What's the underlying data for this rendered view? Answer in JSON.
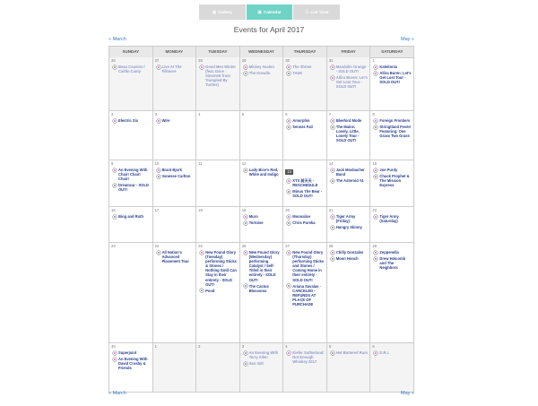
{
  "tabs": [
    {
      "label": "Gallery",
      "icon": "grid-icon",
      "active": false
    },
    {
      "label": "Calendar",
      "icon": "calendar-icon",
      "active": true
    },
    {
      "label": "List View",
      "icon": "list-icon",
      "active": false
    }
  ],
  "title": "Events for April 2017",
  "nav": {
    "prev": "« March",
    "next": "May »"
  },
  "days_of_week": [
    "SUNDAY",
    "MONDAY",
    "TUESDAY",
    "WEDNESDAY",
    "THURSDAY",
    "FRIDAY",
    "SATURDAY"
  ],
  "weeks": [
    [
      {
        "n": "26",
        "other": true,
        "events": [
          {
            "t": "Beau Cousins / Caitlin Canty",
            "c": "gray"
          }
        ]
      },
      {
        "n": "27",
        "other": true,
        "events": [
          {
            "t": "Live At The Fillmore",
            "c": "pink"
          }
        ]
      },
      {
        "n": "28",
        "other": true,
        "events": [
          {
            "t": "Good Men Winter (feat. Dave Simonett from Trampled By Turtles)",
            "c": "pink"
          }
        ]
      },
      {
        "n": "29",
        "other": true,
        "events": [
          {
            "t": "Mickey Avalon",
            "c": "pink"
          },
          {
            "t": "The Growlin",
            "c": "gray"
          }
        ]
      },
      {
        "n": "30",
        "other": true,
        "events": [
          {
            "t": "The Shrine",
            "c": "pink"
          },
          {
            "t": "TAUK",
            "c": "gray"
          }
        ]
      },
      {
        "n": "31",
        "other": true,
        "events": [
          {
            "t": "Mandolin Orange - SOLD OUT!",
            "c": "pink"
          },
          {
            "t": "Allira Buren: Let's Get Lost Tour - SOLD OUT!",
            "c": "pink"
          }
        ]
      },
      {
        "n": "1",
        "other": false,
        "events": [
          {
            "t": "Kaleitonia",
            "c": "pink"
          },
          {
            "t": "Allira Buren: Let's Get Lost Tour - SOLD OUT!",
            "c": "pink"
          }
        ]
      }
    ],
    [
      {
        "n": "2",
        "other": false,
        "events": [
          {
            "t": "Electric Six",
            "c": "pink"
          }
        ]
      },
      {
        "n": "3",
        "other": false,
        "events": [
          {
            "t": "Wire",
            "c": "pink"
          }
        ]
      },
      {
        "n": "4",
        "other": false,
        "events": []
      },
      {
        "n": "5",
        "other": false,
        "events": []
      },
      {
        "n": "6",
        "other": false,
        "events": [
          {
            "t": "Amorphis",
            "c": "pink"
          },
          {
            "t": "Senses Fail",
            "c": "gray"
          }
        ]
      },
      {
        "n": "7",
        "other": false,
        "events": [
          {
            "t": "Bleeford Mode",
            "c": "pink"
          },
          {
            "t": "The Maine: Lovely, Little, Lonely Tour - SOLD OUT!",
            "c": "gray"
          }
        ]
      },
      {
        "n": "8",
        "other": false,
        "events": [
          {
            "t": "Foreign Frontiers",
            "c": "pink"
          },
          {
            "t": "Stringtland Fever! Featuring: One Grass Two Grass",
            "c": "gray"
          }
        ]
      }
    ],
    [
      {
        "n": "9",
        "other": false,
        "events": [
          {
            "t": "An Evening With Chair! Chair! Chair!",
            "c": "pink"
          },
          {
            "t": "Dreamcar - SOLD OUT!",
            "c": "gray"
          }
        ]
      },
      {
        "n": "10",
        "other": false,
        "events": [
          {
            "t": "Brant Bjork",
            "c": "pink"
          },
          {
            "t": "Vanesse Carlton",
            "c": "gray"
          }
        ]
      },
      {
        "n": "11",
        "other": false,
        "events": []
      },
      {
        "n": "12",
        "other": false,
        "events": [
          {
            "t": "Lady Bice's Red, White and Indigo",
            "c": "gray"
          }
        ]
      },
      {
        "n": "13",
        "today": true,
        "other": false,
        "events": [
          {
            "t": "XTX 前天天 - RESCHEDULE",
            "c": "pink"
          },
          {
            "t": "Minus The Bear - SOLD OUT!",
            "c": "gray"
          }
        ]
      },
      {
        "n": "14",
        "other": false,
        "events": [
          {
            "t": "Jack Mosbacher Band",
            "c": "pink"
          },
          {
            "t": "The Asteroid #4",
            "c": "gray"
          }
        ]
      },
      {
        "n": "15",
        "other": false,
        "events": [
          {
            "t": "Joe Purdy",
            "c": "pink"
          },
          {
            "t": "Chuck Prophet & The Mission Express",
            "c": "gray"
          }
        ]
      }
    ],
    [
      {
        "n": "16",
        "other": false,
        "events": [
          {
            "t": "Bing and Ruth",
            "c": "gray"
          }
        ]
      },
      {
        "n": "17",
        "other": false,
        "events": []
      },
      {
        "n": "18",
        "other": false,
        "events": []
      },
      {
        "n": "19",
        "other": false,
        "events": [
          {
            "t": "Muro",
            "c": "pink"
          },
          {
            "t": "Tortoise",
            "c": "gray"
          }
        ]
      },
      {
        "n": "20",
        "other": false,
        "events": [
          {
            "t": "Moonalice",
            "c": "pink"
          },
          {
            "t": "Chris Pureka",
            "c": "gray"
          }
        ]
      },
      {
        "n": "21",
        "other": false,
        "events": [
          {
            "t": "Tiger Army (Friday)",
            "c": "pink"
          },
          {
            "t": "Hungry Skinny",
            "c": "gray"
          }
        ]
      },
      {
        "n": "22",
        "other": false,
        "events": [
          {
            "t": "Tiger Army (Saturday)",
            "c": "pink"
          }
        ]
      }
    ],
    [
      {
        "n": "23",
        "other": false,
        "events": []
      },
      {
        "n": "24",
        "other": false,
        "events": [
          {
            "t": "All Nation's Advanced Placement Tour",
            "c": "gray"
          }
        ]
      },
      {
        "n": "25",
        "other": false,
        "events": [
          {
            "t": "New Found Glory (Tuesday) performing Sticks & Stones / Nothing Gold Can Stay in their entirety - SOLD OUT!",
            "c": "pink"
          },
          {
            "t": "Pond",
            "c": "gray"
          }
        ]
      },
      {
        "n": "26",
        "other": false,
        "events": [
          {
            "t": "New Found Glory (Wednesday) performing Catalyst / Self-Titled in their entirety - SOLD OUT!",
            "c": "pink"
          },
          {
            "t": "The Cactus Blossoms",
            "c": "gray"
          }
        ]
      },
      {
        "n": "27",
        "other": false,
        "events": [
          {
            "t": "New Found Glory (Thursday) performing Sticks and Stones / Coming Home in their entirety - SOLD OUT!",
            "c": "pink"
          },
          {
            "t": "Ariana Savalas - CANCELED - REFUNDS AT PLACE OF PURCHASE",
            "c": "gray"
          }
        ]
      },
      {
        "n": "28",
        "other": false,
        "events": [
          {
            "t": "Chilly Gonzales",
            "c": "pink"
          },
          {
            "t": "Moon Hooch",
            "c": "gray"
          }
        ]
      },
      {
        "n": "29",
        "other": false,
        "events": [
          {
            "t": "Zeppenella",
            "c": "pink"
          },
          {
            "t": "Drew Holcomb and The Neighbors",
            "c": "gray"
          }
        ]
      }
    ],
    [
      {
        "n": "30",
        "other": false,
        "events": [
          {
            "t": "Superjoint",
            "c": "pink"
          },
          {
            "t": "An Evening With David Crosby & Friends",
            "c": "pink"
          }
        ]
      },
      {
        "n": "1",
        "other": true,
        "events": []
      },
      {
        "n": "2",
        "other": true,
        "events": []
      },
      {
        "n": "3",
        "other": true,
        "events": [
          {
            "t": "An Evening With Terry Allen",
            "c": "gray"
          },
          {
            "t": "San Volt",
            "c": "gray"
          }
        ]
      },
      {
        "n": "4",
        "other": true,
        "events": [
          {
            "t": "Kiefer Sutherland: Not Enough Whiskey 2017",
            "c": "pink"
          }
        ]
      },
      {
        "n": "5",
        "other": true,
        "events": [
          {
            "t": "Hot Buttered Rum",
            "c": "gray"
          }
        ]
      },
      {
        "n": "6",
        "other": true,
        "events": [
          {
            "t": "D.R.I.",
            "c": "pink"
          }
        ]
      }
    ]
  ]
}
